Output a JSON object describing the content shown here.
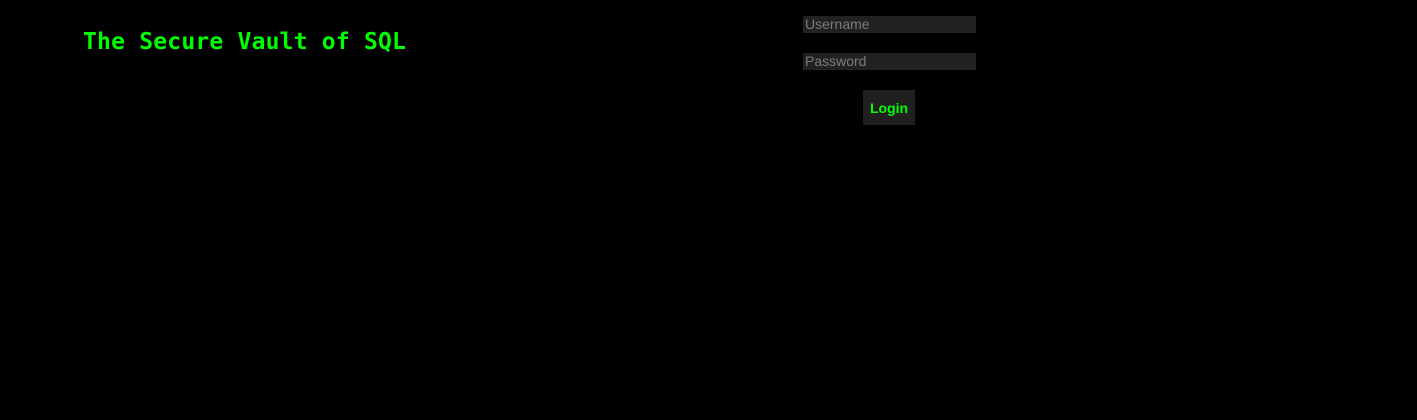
{
  "page": {
    "title": "The Secure Vault of SQL"
  },
  "login": {
    "username_placeholder": "Username",
    "username_value": "",
    "password_placeholder": "Password",
    "password_value": "",
    "button_label": "Login"
  },
  "colors": {
    "background": "#000000",
    "accent": "#00ff00",
    "field_background": "#222222",
    "button_background": "#202020",
    "placeholder": "#7a7a7a"
  }
}
